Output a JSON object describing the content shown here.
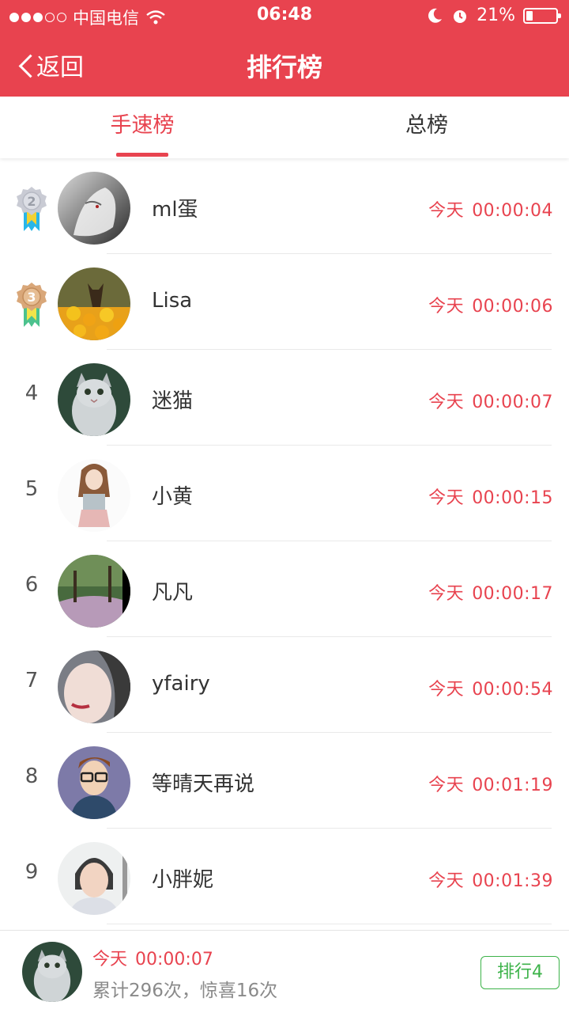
{
  "status_bar": {
    "carrier": "中国电信",
    "time": "06:48",
    "battery": "21%"
  },
  "nav": {
    "back_label": "返回",
    "title": "排行榜"
  },
  "tabs": [
    {
      "label": "手速榜",
      "active": true
    },
    {
      "label": "总榜",
      "active": false
    }
  ],
  "colors": {
    "accent": "#e8434f",
    "green": "#3db34a"
  },
  "ranking": [
    {
      "rank": "2",
      "medal": "silver",
      "name": "ml蛋",
      "day": "今天",
      "time": "00:00:04",
      "avatar": "wolf-avatar"
    },
    {
      "rank": "3",
      "medal": "bronze",
      "name": "Lisa",
      "day": "今天",
      "time": "00:00:06",
      "avatar": "dog-flowers-avatar"
    },
    {
      "rank": "4",
      "medal": "",
      "name": "迷猫",
      "day": "今天",
      "time": "00:00:07",
      "avatar": "kitten-avatar"
    },
    {
      "rank": "5",
      "medal": "",
      "name": "小黄",
      "day": "今天",
      "time": "00:00:15",
      "avatar": "girl-drawing-avatar"
    },
    {
      "rank": "6",
      "medal": "",
      "name": "凡凡",
      "day": "今天",
      "time": "00:00:17",
      "avatar": "park-avatar"
    },
    {
      "rank": "7",
      "medal": "",
      "name": "yfairy",
      "day": "今天",
      "time": "00:00:54",
      "avatar": "face-avatar"
    },
    {
      "rank": "8",
      "medal": "",
      "name": "等晴天再说",
      "day": "今天",
      "time": "00:01:19",
      "avatar": "cartoon-man-avatar"
    },
    {
      "rank": "9",
      "medal": "",
      "name": "小胖妮",
      "day": "今天",
      "time": "00:01:39",
      "avatar": "woman-photo-avatar"
    }
  ],
  "footer": {
    "day": "今天",
    "time": "00:00:07",
    "stats": "累计296次，惊喜16次",
    "rank_button": "排行4",
    "avatar": "kitten-avatar"
  }
}
